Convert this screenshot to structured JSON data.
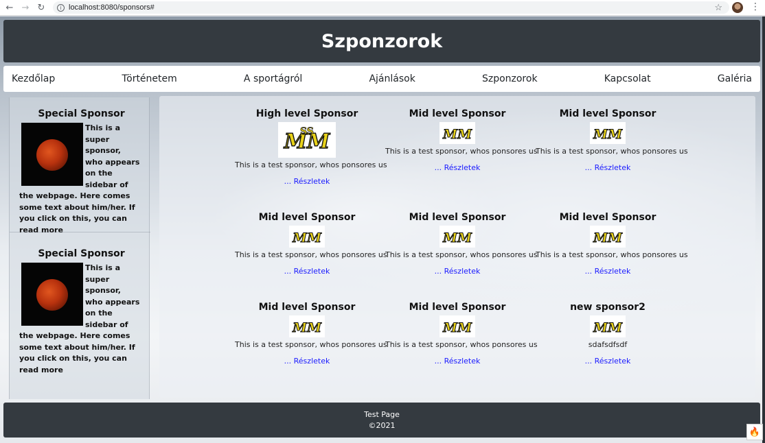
{
  "browser": {
    "url": "localhost:8080/sponsors#",
    "back_icon": "back-arrow-icon",
    "forward_icon": "forward-arrow-icon",
    "reload_icon": "reload-icon"
  },
  "header": {
    "title": "Szponzorok"
  },
  "nav": {
    "items": [
      "Kezdőlap",
      "Történetem",
      "A sportágról",
      "Ajánlások",
      "Szponzorok",
      "Kapcsolat",
      "Galéria"
    ]
  },
  "sidebar": {
    "cards": [
      {
        "title": "Special Sponsor",
        "text": "This is a super sponsor, who appears on the sidebar of the webpage. Here comes some text about him/her. If you click on this, you can read more"
      },
      {
        "title": "Special Sponsor",
        "text": "This is a super sponsor, who appears on the sidebar of the webpage. Here comes some text about him/her. If you click on this, you can read more"
      }
    ]
  },
  "sponsors": [
    {
      "title": "High level Sponsor",
      "desc": "This is a test sponsor, whos ponsores us",
      "link": "... Részletek"
    },
    {
      "title": "Mid level Sponsor",
      "desc": "This is a test sponsor, whos ponsores us",
      "link": "... Részletek"
    },
    {
      "title": "Mid level Sponsor",
      "desc": "This is a test sponsor, whos ponsores us",
      "link": "... Részletek"
    },
    {
      "title": "Mid level Sponsor",
      "desc": "This is a test sponsor, whos ponsores us",
      "link": "... Részletek"
    },
    {
      "title": "Mid level Sponsor",
      "desc": "This is a test sponsor, whos ponsores us",
      "link": "... Részletek"
    },
    {
      "title": "Mid level Sponsor",
      "desc": "This is a test sponsor, whos ponsores us",
      "link": "... Részletek"
    },
    {
      "title": "Mid level Sponsor",
      "desc": "This is a test sponsor, whos ponsores us",
      "link": "... Részletek"
    },
    {
      "title": "Mid level Sponsor",
      "desc": "This is a test sponsor, whos ponsores us",
      "link": "... Részletek"
    },
    {
      "title": "new sponsor2",
      "desc": "sdafsdfsdf",
      "link": "... Részletek"
    }
  ],
  "footer": {
    "line1": "Test Page",
    "line2": "©2021"
  },
  "colors": {
    "dark": "#343a40",
    "link": "#1a1aff"
  }
}
